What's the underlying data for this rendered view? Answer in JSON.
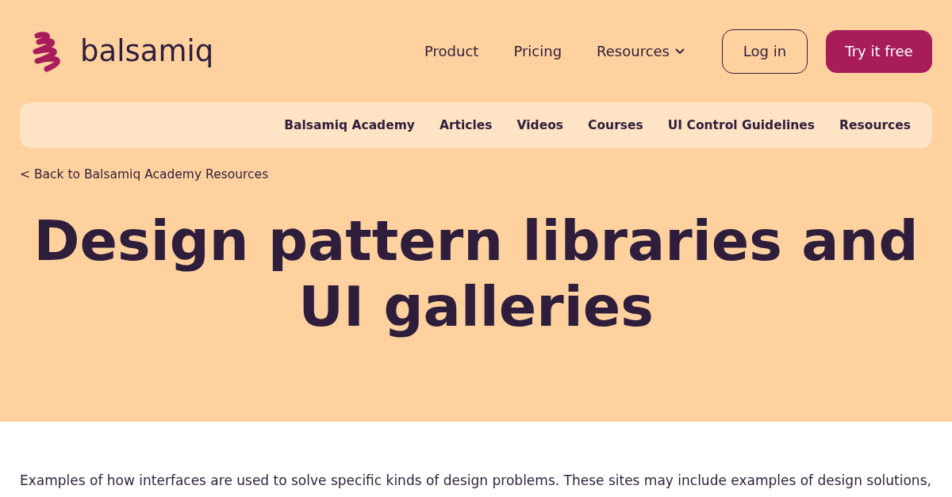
{
  "logo": {
    "text": "balsamiq"
  },
  "nav": [
    {
      "label": "Product",
      "kind": "link"
    },
    {
      "label": "Pricing",
      "kind": "link"
    },
    {
      "label": "Resources",
      "kind": "dropdown"
    }
  ],
  "login": {
    "label": "Log in"
  },
  "cta": {
    "label": "Try it free"
  },
  "subnav": [
    "Balsamiq Academy",
    "Articles",
    "Videos",
    "Courses",
    "UI Control Guidelines",
    "Resources"
  ],
  "back_link": "< Back to Balsamiq Academy Resources",
  "title": "Design pattern libraries and UI galleries",
  "intro": "Examples of how interfaces are used to solve specific kinds of design problems. These sites may include examples of design solutions,"
}
